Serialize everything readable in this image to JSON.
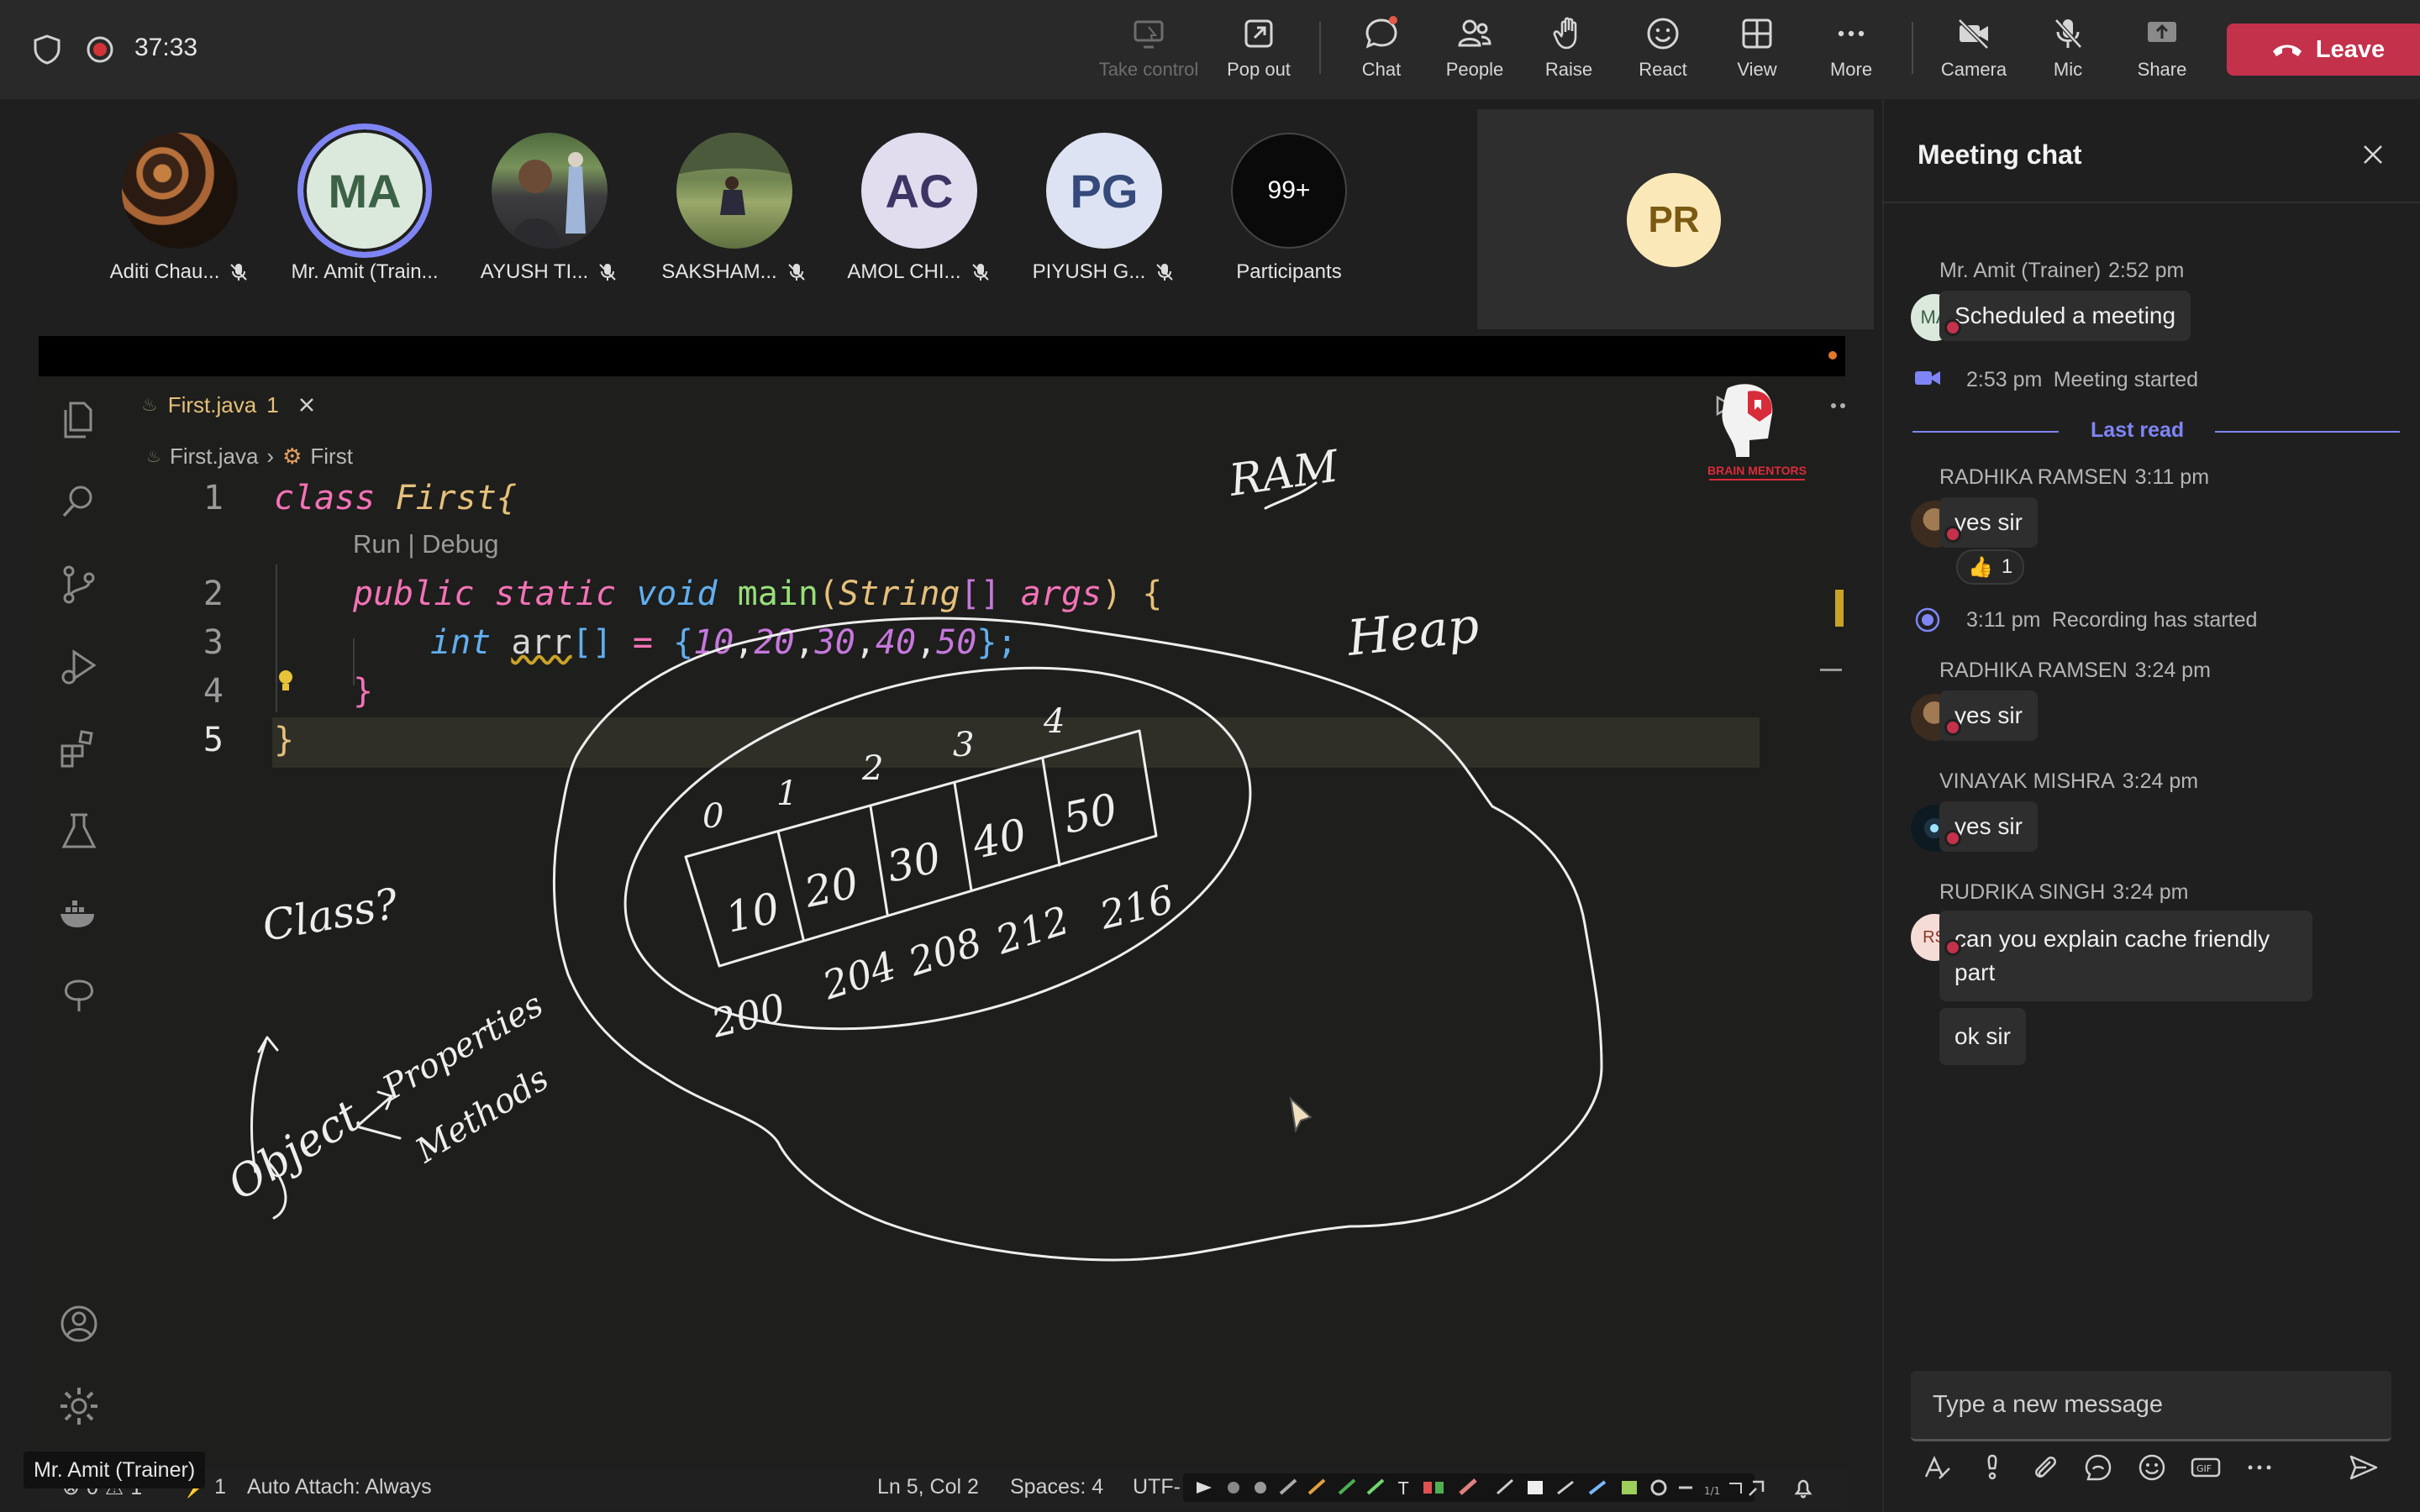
{
  "meeting": {
    "timer": "37:33"
  },
  "toolbar": {
    "take_control": "Take control",
    "pop_out": "Pop out",
    "chat": "Chat",
    "people": "People",
    "raise": "Raise",
    "react": "React",
    "view": "View",
    "more": "More",
    "camera": "Camera",
    "mic": "Mic",
    "share": "Share",
    "leave": "Leave"
  },
  "participants": [
    {
      "name": "Aditi Chau...",
      "initials": "",
      "muted": true
    },
    {
      "name": "Mr. Amit (Train...",
      "initials": "MA",
      "muted": false
    },
    {
      "name": "AYUSH TI...",
      "initials": "",
      "muted": true
    },
    {
      "name": "SAKSHAM...",
      "initials": "",
      "muted": true
    },
    {
      "name": "AMOL CHI...",
      "initials": "AC",
      "muted": true
    },
    {
      "name": "PIYUSH G...",
      "initials": "PG",
      "muted": true
    }
  ],
  "overflow": {
    "count": "99+",
    "label": "Participants"
  },
  "spotlight": {
    "initials": "PR"
  },
  "editor": {
    "tab_title": "First.java",
    "tab_badge": "1",
    "breadcrumb_file": "First.java",
    "breadcrumb_class": "First",
    "codelens": "Run | Debug",
    "lines": [
      "1",
      "2",
      "3",
      "4",
      "5"
    ],
    "code": {
      "l1_kw": "class",
      "l1_name": "First{",
      "l2_a": "public",
      "l2_b": "static",
      "l2_c": "void",
      "l2_d": "main",
      "l2_e": "(",
      "l2_f": "String",
      "l2_g": "[]",
      "l2_h": "args",
      "l2_i": ") {",
      "l3_a": "int",
      "l3_b": "arr",
      "l3_c": "[]",
      "l3_d": " = ",
      "l3_e": "{",
      "l3_f": "10",
      "l3_g": "20",
      "l3_h": "30",
      "l3_i": "40",
      "l3_j": "50",
      "l3_k": "};",
      "l4": "}",
      "l5": "}"
    },
    "brand": "BRAIN MENTORS",
    "status": {
      "problems": "0",
      "warnings": "1",
      "ports": "1",
      "auto_attach": "Auto Attach: Always",
      "position": "Ln 5, Col 2",
      "spaces": "Spaces: 4",
      "encoding": "UTF-"
    }
  },
  "annotations": {
    "ram": "RAM",
    "heap": "Heap",
    "class": "Class?",
    "object": "Object",
    "properties": "Properties",
    "methods": "Methods",
    "indices": [
      "0",
      "1",
      "2",
      "3",
      "4"
    ],
    "values": [
      "10",
      "20",
      "30",
      "40",
      "50"
    ],
    "addresses": [
      "200",
      "204",
      "208",
      "212",
      "216"
    ]
  },
  "presenter_tag": "Mr. Amit (Trainer)",
  "chat": {
    "title": "Meeting chat",
    "messages": [
      {
        "author": "Mr. Amit (Trainer)",
        "time": "2:52 pm",
        "text": "Scheduled a meeting"
      },
      {
        "system_time": "2:53 pm",
        "system_text": "Meeting started"
      },
      {
        "divider": "Last read"
      },
      {
        "author": "RADHIKA RAMSEN",
        "time": "3:11 pm",
        "text": "yes sir",
        "reaction": "👍",
        "reaction_count": "1"
      },
      {
        "system_time": "3:11 pm",
        "system_text": "Recording has started"
      },
      {
        "author": "RADHIKA RAMSEN",
        "time": "3:24 pm",
        "text": "yes sir"
      },
      {
        "author": "VINAYAK MISHRA",
        "time": "3:24 pm",
        "text": "yes sir"
      },
      {
        "author": "RUDRIKA SINGH",
        "time": "3:24 pm",
        "text": "can you explain cache friendly part",
        "text2": "ok sir",
        "initials": "RS"
      }
    ],
    "compose_placeholder": "Type a new message",
    "amit_initials": "MA"
  },
  "colors": {
    "leave": "#c4314b",
    "accent": "#7f85f5",
    "keyword": "#f472b6",
    "classname": "#e5c07b"
  }
}
